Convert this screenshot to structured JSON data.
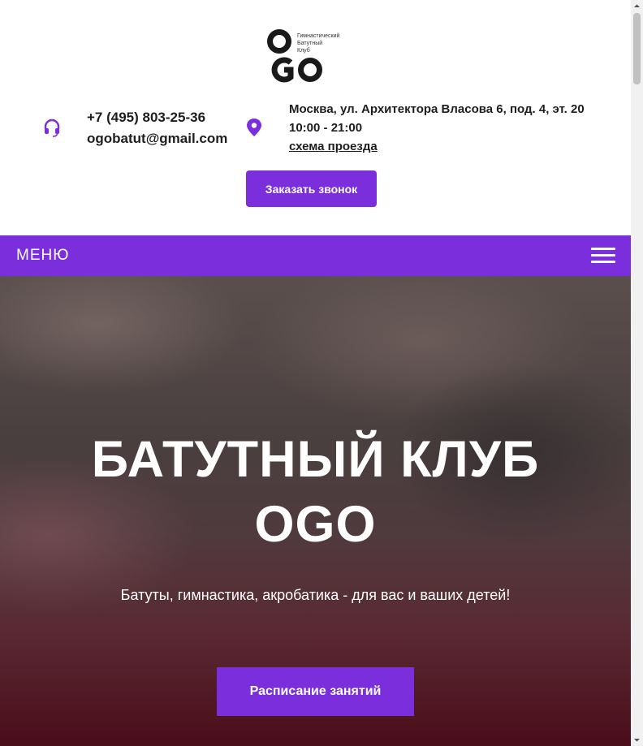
{
  "header": {
    "logo": {
      "mark_text": "OGO",
      "caption": [
        "Гимнастический",
        "Батутный",
        "Клуб"
      ]
    },
    "phone": "+7 (495) 803-25-36",
    "email": "ogobatut@gmail.com",
    "address": "Москва, ул. Архитектора Власова 6, под. 4, эт. 20",
    "hours": "10:00 - 21:00",
    "route_link": "схема проезда",
    "callback_button": "Заказать звонок"
  },
  "nav": {
    "menu_label": "МЕНЮ",
    "burger_icon": "hamburger-icon"
  },
  "hero": {
    "title_line1": "БАТУТНЫЙ КЛУБ",
    "title_line2": "OGO",
    "subtitle": "Батуты, гимнастика, акробатика - для вас и ваших детей!",
    "schedule_button": "Расписание занятий"
  },
  "icons": {
    "phone": "headset-icon",
    "location": "map-pin-icon"
  },
  "colors": {
    "accent": "#7b2fdc",
    "text_dark": "#1e1e1e",
    "hero_text": "#ffffff"
  }
}
